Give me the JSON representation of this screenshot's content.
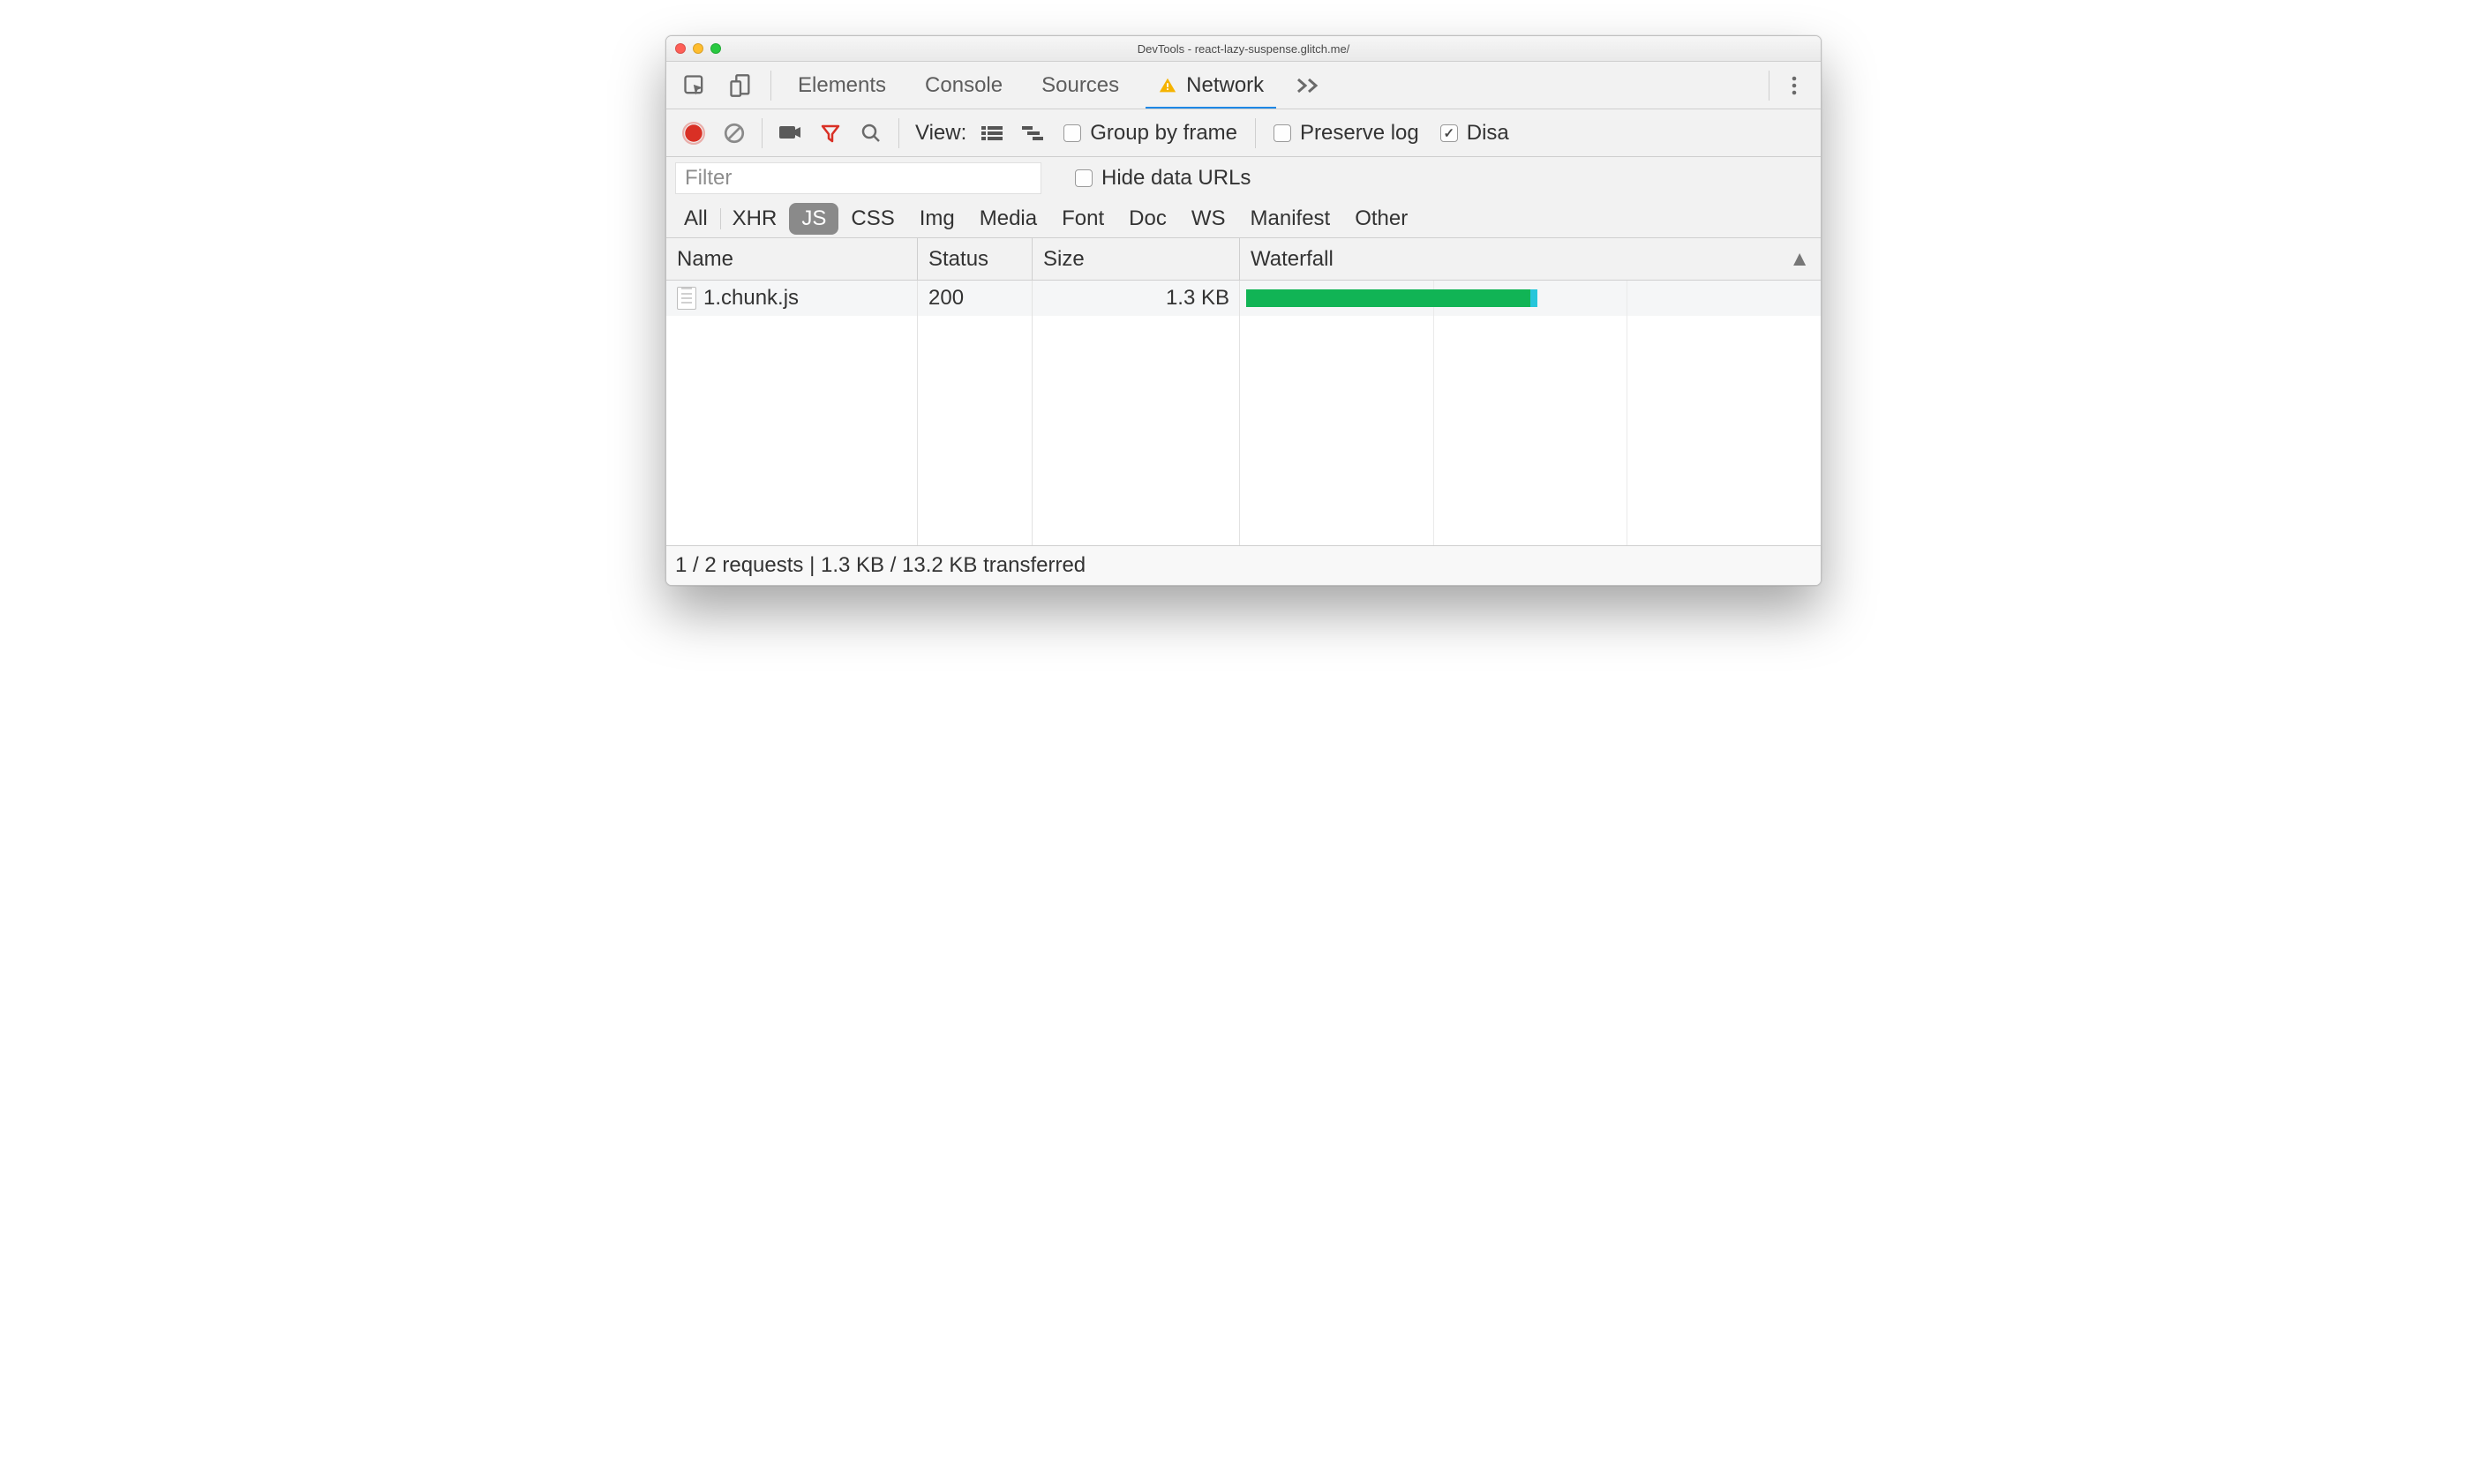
{
  "window": {
    "title": "DevTools - react-lazy-suspense.glitch.me/"
  },
  "tabs": {
    "items": [
      "Elements",
      "Console",
      "Sources",
      "Network"
    ],
    "active_index": 3,
    "network_warning": true
  },
  "toolbar": {
    "view_label": "View:",
    "group_by_frame": {
      "label": "Group by frame",
      "checked": false
    },
    "preserve_log": {
      "label": "Preserve log",
      "checked": false
    },
    "disable_cache": {
      "label": "Disa",
      "checked": true
    },
    "filter_active": true,
    "recording": true
  },
  "filter": {
    "placeholder": "Filter",
    "value": "",
    "hide_data_urls": {
      "label": "Hide data URLs",
      "checked": false
    }
  },
  "types": {
    "items": [
      "All",
      "XHR",
      "JS",
      "CSS",
      "Img",
      "Media",
      "Font",
      "Doc",
      "WS",
      "Manifest",
      "Other"
    ],
    "active_index": 2
  },
  "table": {
    "columns": [
      "Name",
      "Status",
      "Size",
      "Waterfall"
    ],
    "rows": [
      {
        "name": "1.chunk.js",
        "status": "200",
        "size": "1.3 KB",
        "waterfall": {
          "start_pct": 0,
          "width_pct": 50
        }
      }
    ]
  },
  "status": {
    "text": "1 / 2 requests | 1.3 KB / 13.2 KB transferred"
  }
}
